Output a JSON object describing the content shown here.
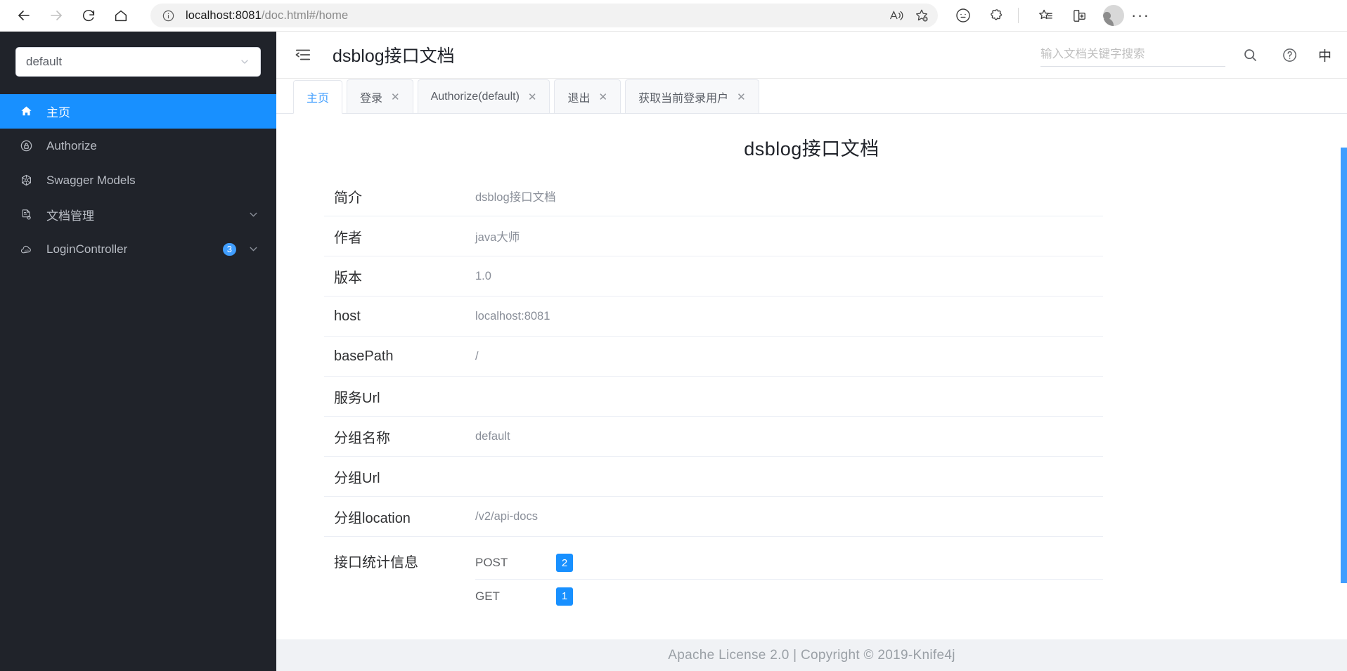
{
  "browser": {
    "back_label": "Back",
    "forward_label": "Forward",
    "reload_label": "Refresh",
    "home_label": "Home",
    "url_host": "localhost:8081",
    "url_path": "/doc.html#/home",
    "read_aloud_label": "Read aloud",
    "favorite_label": "Add to favorites",
    "browser_essentials_label": "Browser essentials",
    "extensions_label": "Extensions",
    "collections_label": "Collections",
    "split_screen_label": "Split screen",
    "profile_label": "Profile",
    "settings_label": "Settings and more"
  },
  "sidebar": {
    "group_select": {
      "value": "default"
    },
    "items": [
      {
        "label": "主页",
        "icon": "home-icon",
        "active": true,
        "badge": "",
        "expandable": false
      },
      {
        "label": "Authorize",
        "icon": "lock-icon",
        "active": false,
        "badge": "",
        "expandable": false
      },
      {
        "label": "Swagger Models",
        "icon": "cube-icon",
        "active": false,
        "badge": "",
        "expandable": false
      },
      {
        "label": "文档管理",
        "icon": "doc-gear-icon",
        "active": false,
        "badge": "",
        "expandable": true
      },
      {
        "label": "LoginController",
        "icon": "api-cloud-icon",
        "active": false,
        "badge": "3",
        "expandable": true
      }
    ]
  },
  "topbar": {
    "collapse_icon": "collapse-menu-icon",
    "title": "dsblog接口文档",
    "search_placeholder": "输入文档关键字搜索",
    "search_value": "",
    "search_icon": "search-icon",
    "help_icon": "question-circle-icon",
    "lang_label": "中"
  },
  "tabs": [
    {
      "label": "主页",
      "closable": false,
      "active": true
    },
    {
      "label": "登录",
      "closable": true,
      "active": false
    },
    {
      "label": "Authorize(default)",
      "closable": true,
      "active": false
    },
    {
      "label": "退出",
      "closable": true,
      "active": false
    },
    {
      "label": "获取当前登录用户",
      "closable": true,
      "active": false
    }
  ],
  "tab_close_glyph": "✕",
  "content": {
    "title": "dsblog接口文档",
    "rows": [
      {
        "label": "简介",
        "value": "dsblog接口文档"
      },
      {
        "label": "作者",
        "value": "java大师"
      },
      {
        "label": "版本",
        "value": "1.0"
      },
      {
        "label": "host",
        "value": "localhost:8081"
      },
      {
        "label": "basePath",
        "value": "/"
      },
      {
        "label": "服务Url",
        "value": ""
      },
      {
        "label": "分组名称",
        "value": "default"
      },
      {
        "label": "分组Url",
        "value": ""
      },
      {
        "label": "分组location",
        "value": "/v2/api-docs"
      }
    ],
    "stats_label": "接口统计信息",
    "stats": [
      {
        "method": "POST",
        "count": "2"
      },
      {
        "method": "GET",
        "count": "1"
      }
    ]
  },
  "footer": {
    "text": "Apache License 2.0 | Copyright © 2019-Knife4j"
  },
  "colors": {
    "accent": "#1890ff",
    "sidebar_bg": "#20232a",
    "badge": "#409eff",
    "footer_bg": "#f0f2f5"
  }
}
